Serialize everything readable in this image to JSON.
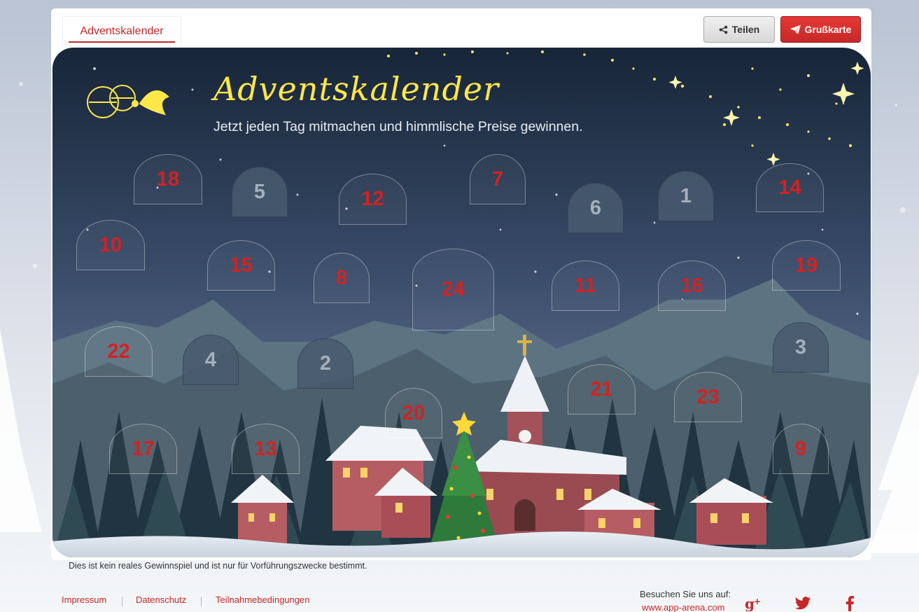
{
  "tab": {
    "label": "Adventskalender"
  },
  "buttons": {
    "share": "Teilen",
    "greeting_card": "Grußkarte"
  },
  "header": {
    "title": "Adventskalender",
    "subtitle": "Jetzt jeden Tag mitmachen und himmlische Preise gewinnen."
  },
  "doors": [
    {
      "day": "18",
      "state": "closed"
    },
    {
      "day": "5",
      "state": "opened"
    },
    {
      "day": "12",
      "state": "closed"
    },
    {
      "day": "7",
      "state": "closed"
    },
    {
      "day": "6",
      "state": "opened"
    },
    {
      "day": "1",
      "state": "opened"
    },
    {
      "day": "14",
      "state": "closed"
    },
    {
      "day": "10",
      "state": "closed"
    },
    {
      "day": "15",
      "state": "closed"
    },
    {
      "day": "8",
      "state": "closed"
    },
    {
      "day": "24",
      "state": "closed"
    },
    {
      "day": "11",
      "state": "closed"
    },
    {
      "day": "16",
      "state": "closed"
    },
    {
      "day": "19",
      "state": "closed"
    },
    {
      "day": "22",
      "state": "closed"
    },
    {
      "day": "4",
      "state": "opened"
    },
    {
      "day": "2",
      "state": "opened"
    },
    {
      "day": "3",
      "state": "opened"
    },
    {
      "day": "21",
      "state": "closed"
    },
    {
      "day": "23",
      "state": "closed"
    },
    {
      "day": "20",
      "state": "closed"
    },
    {
      "day": "17",
      "state": "closed"
    },
    {
      "day": "13",
      "state": "closed"
    },
    {
      "day": "9",
      "state": "closed"
    }
  ],
  "disclaimer": "Dies ist kein reales Gewinnspiel und ist nur für Vorführungszwecke bestimmt.",
  "footer": {
    "links": [
      "Impressum",
      "Datenschutz",
      "Teilnahmebedingungen"
    ],
    "visit_label": "Besuchen Sie uns auf:",
    "visit_url": "www.app-arena.com"
  },
  "social": {
    "icons": [
      "google-plus-icon",
      "twitter-icon",
      "facebook-icon"
    ]
  },
  "colors": {
    "accent": "#c62828",
    "title_yellow": "#ffe74a",
    "sky_top": "#1a2a40"
  }
}
